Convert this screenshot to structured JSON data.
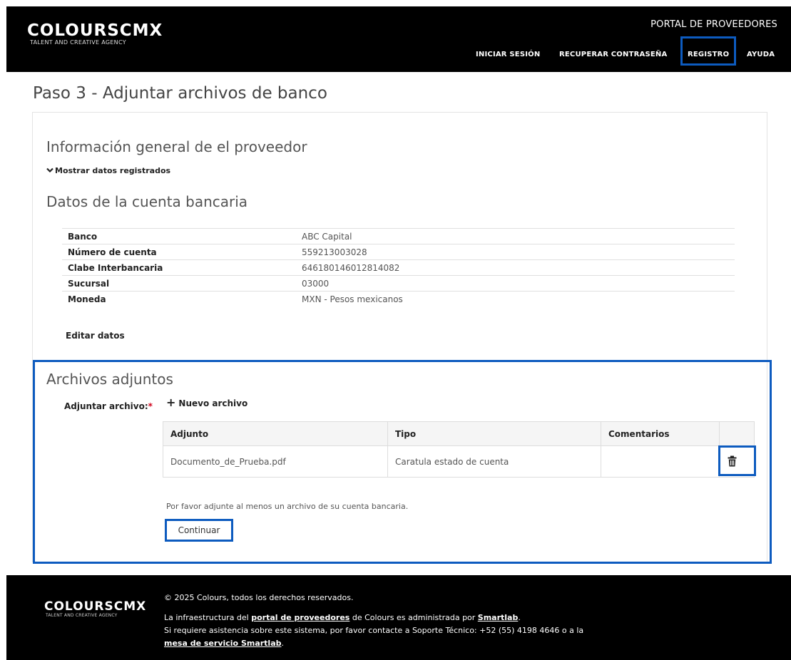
{
  "header": {
    "logo_main": "COLOURSCMX",
    "logo_sub": "TALENT AND CREATIVE AGENCY",
    "portal_title": "PORTAL DE PROVEEDORES",
    "nav": {
      "login": "INICIAR SESIÓN",
      "recover": "RECUPERAR CONTRASEÑA",
      "register": "REGISTRO",
      "help": "AYUDA"
    }
  },
  "page": {
    "title": "Paso 3 - Adjuntar archivos de banco"
  },
  "general": {
    "title": "Información general de el proveedor",
    "toggle_label": "Mostrar datos registrados"
  },
  "bank": {
    "title": "Datos de la cuenta bancaria",
    "rows": [
      {
        "label": "Banco",
        "value": "ABC Capital"
      },
      {
        "label": "Número de cuenta",
        "value": "559213003028"
      },
      {
        "label": "Clabe Interbancaria",
        "value": "646180146012814082"
      },
      {
        "label": "Sucursal",
        "value": "03000"
      },
      {
        "label": "Moneda",
        "value": "MXN - Pesos mexicanos"
      }
    ],
    "edit_label": "Editar datos"
  },
  "attachments": {
    "title": "Archivos adjuntos",
    "attach_label": "Adjuntar archivo:",
    "required_mark": "*",
    "new_file_label": "Nuevo archivo",
    "columns": [
      "Adjunto",
      "Tipo",
      "Comentarios"
    ],
    "rows": [
      {
        "file": "Documento_de_Prueba.pdf",
        "type": "Caratula estado de cuenta",
        "comments": ""
      }
    ],
    "hint": "Por favor adjunte al menos un archivo de su cuenta bancaria.",
    "continue_label": "Continuar"
  },
  "footer": {
    "logo_main": "COLOURSCMX",
    "logo_sub": "TALENT AND CREATIVE AGENCY",
    "copyright": "© 2025 Colours, todos los derechos reservados.",
    "line1_pre": "La infraestructura del ",
    "line1_link1": "portal de proveedores",
    "line1_mid": " de Colours es administrada por ",
    "line1_link2": "Smartlab",
    "line1_post": ".",
    "line2": "Si requiere asistencia sobre este sistema, por favor contacte a Soporte Técnico: +52 (55) 4198 4646 o a la",
    "line3_link": "mesa de servicio Smartlab",
    "line3_post": "."
  },
  "colors": {
    "highlight": "#0d5bbf",
    "header_bg": "#000000",
    "required": "#d0021b"
  },
  "icons": {
    "toggle": "chevron-down-icon",
    "new_file": "plus-icon",
    "delete": "trash-icon"
  }
}
